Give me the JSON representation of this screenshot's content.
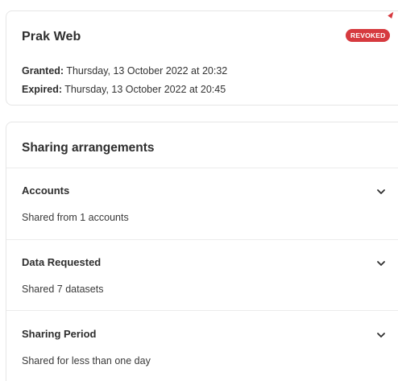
{
  "consent": {
    "app_name": "Prak Web",
    "status_badge": "REVOKED",
    "granted_label": "Granted:",
    "granted_value": " Thursday, 13 October 2022 at 20:32",
    "expired_label": "Expired:",
    "expired_value": " Thursday, 13 October 2022 at 20:45"
  },
  "sharing": {
    "title": "Sharing arrangements",
    "items": [
      {
        "title": "Accounts",
        "description": "Shared from 1 accounts"
      },
      {
        "title": "Data Requested",
        "description": "Shared 7 datasets"
      },
      {
        "title": "Sharing Period",
        "description": "Shared for less than one day"
      }
    ]
  },
  "colors": {
    "badge": "#d63a3f",
    "divider": "#ececec",
    "border": "#e6e6e6"
  },
  "icons": {
    "expand": "chevron-down-icon"
  }
}
